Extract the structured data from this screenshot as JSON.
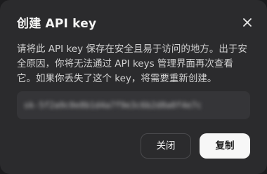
{
  "dialog": {
    "title": "创建 API key",
    "description": "请将此 API key 保存在安全且易于访问的地方。出于安全原因，你将无法通过 API keys 管理界面再次查看它。如果你丢失了这个 key，将需要重新创建。",
    "key_value": "sk-5f2a9c0e8b1d4a7f9e3c6b2d8a0f4e7c",
    "close_icon": "close-icon",
    "buttons": {
      "close_label": "关闭",
      "copy_label": "复制"
    }
  },
  "colors": {
    "dialog_bg": "#2b2b2d",
    "field_bg": "#353538",
    "primary_button_bg": "#f7f7f7",
    "text_primary": "#f5f5f5"
  }
}
